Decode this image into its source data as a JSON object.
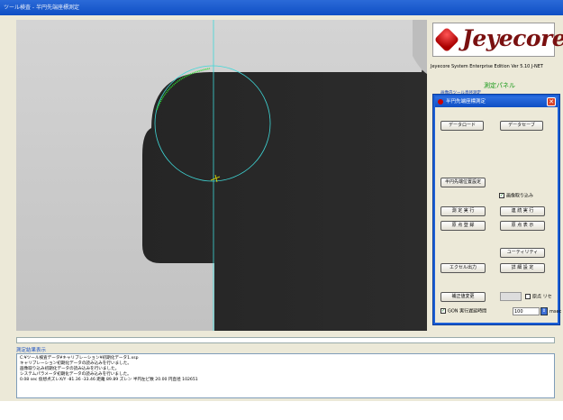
{
  "window": {
    "title": "ツール検査 - 半円先端座標測定"
  },
  "logo": {
    "text": "Jeyecore"
  },
  "edition": "Jeyecore System Enterprise Edition Ver 5.10 J-NET",
  "panel": {
    "title": "測定パネル",
    "subtitle": "画像内ツール直径測定"
  },
  "dialog": {
    "title": "半円先端座標測定",
    "close": "✕",
    "data_load": "データロード",
    "data_save": "データセーブ",
    "position_setting": "半円先端位置設定",
    "image_capture": "画像取り込み",
    "measure_run": "測 定 実 行",
    "continuous_run": "連 続 実 行",
    "origin_register": "原 点 登 録",
    "origin_display": "原 点 表 示",
    "utility": "ユーティリティ",
    "excel_output": "エクセル出力",
    "detail_setting": "詳 細 設 定",
    "correction_change": "補正値変更",
    "origin_reset": "原点 リセ",
    "gon_label": "GON 実行遅延時間",
    "delay_value": "100",
    "msec": "msec"
  },
  "results": {
    "label": "測定結果表示",
    "lines": [
      "C:¥ツール検査データ¥キャリブレーション¥初期化データ1.xsp",
      "キャリブレーション初期化データの読み込みを行いました。",
      "画像取り込み初期化データの読み込みを行いました。",
      "システムパラメータ初期化データの読み込みを行いました。",
      "0.08 sec  仮想点ズレX/Y -81.36 -33.46 距離 89.89 ズレン 半円左ピ数 20.00 円直径 102651"
    ]
  },
  "colors": {
    "dialog_border": "#1c5fd6",
    "cyan_line": "#3fd8d8",
    "edge_green": "#2ee02e"
  }
}
